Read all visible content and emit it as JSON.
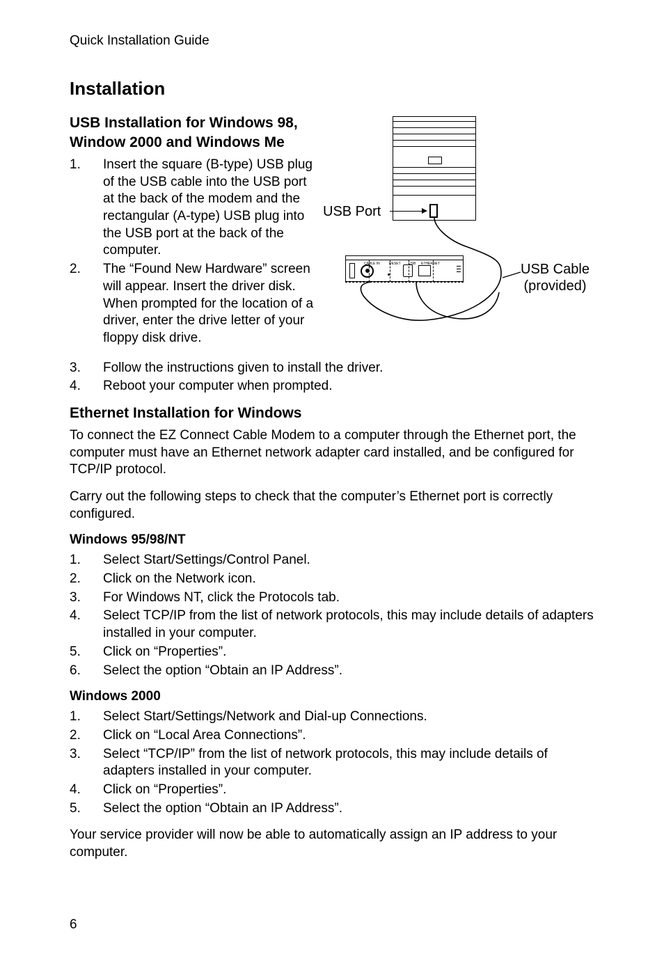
{
  "header": "Quick Installation Guide",
  "title": "Installation",
  "usb_section": {
    "heading_l1": "USB Installation for Windows 98,",
    "heading_l2": "Window 2000 and Windows Me",
    "steps": [
      "Insert the square (B-type) USB plug of the USB cable into the USB port at the back of the modem and the rectangular (A-type) USB plug into the USB port at the back of the computer.",
      "The “Found New Hardware” screen will appear. Insert the driver disk. When prompted for the location of a driver, enter the drive letter of your floppy disk drive.",
      "Follow the instructions given to install the driver.",
      "Reboot your computer when prompted."
    ]
  },
  "diagram": {
    "usb_port_label": "USB Port",
    "cable_label_l1": "USB Cable",
    "cable_label_l2": "(provided)",
    "modem_labels": {
      "cablein": "CABLE IN",
      "reset": "RESET",
      "usb": "USB",
      "ethernet": "ETHERNET"
    }
  },
  "ethernet_section": {
    "heading": "Ethernet Installation for Windows",
    "para1": "To connect the EZ Connect Cable Modem to a computer through the Ethernet port, the computer must have an Ethernet network adapter card installed, and be configured for TCP/IP protocol.",
    "para2": "Carry out the following steps to check that the computer’s Ethernet port is correctly configured."
  },
  "win9598nt": {
    "heading": "Windows 95/98/NT",
    "steps": [
      "Select Start/Settings/Control Panel.",
      "Click on the Network icon.",
      "For Windows NT, click the Protocols tab.",
      "Select TCP/IP from the list of network protocols, this may include details of adapters installed in your computer.",
      "Click on “Properties”.",
      "Select the option “Obtain an IP Address”."
    ]
  },
  "win2000": {
    "heading": "Windows 2000",
    "steps": [
      "Select Start/Settings/Network and Dial-up Connections.",
      "Click on “Local Area Connections”.",
      "Select “TCP/IP” from the list of network protocols, this may include details of adapters installed in your computer.",
      "Click on “Properties”.",
      "Select the option “Obtain an IP Address”."
    ]
  },
  "closing": "Your service provider will now be able to automatically assign an IP address to your computer.",
  "page_number": "6"
}
